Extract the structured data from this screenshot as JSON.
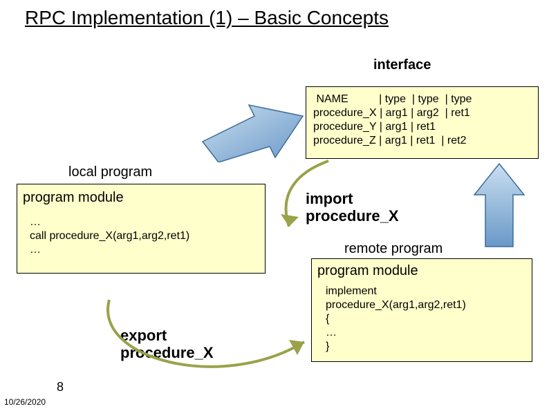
{
  "title": "RPC Implementation (1) – Basic Concepts",
  "labels": {
    "interface": "interface",
    "local_program": "local program",
    "import": "import\nprocedure_X",
    "remote_program": "remote program",
    "export": "export\nprocedure_X"
  },
  "interface_box": {
    "line1": " NAME          | type  | type  | type",
    "line2": "procedure_X | arg1 | arg2  | ret1",
    "line3": "procedure_Y | arg1 | ret1",
    "line4": "procedure_Z | arg1 | ret1  | ret2"
  },
  "local_module": {
    "heading": "program module",
    "body1": "…",
    "body2": "call procedure_X(arg1,arg2,ret1)",
    "body3": "…"
  },
  "remote_module": {
    "heading": "program module",
    "body1": "implement",
    "body2": "procedure_X(arg1,arg2,ret1)",
    "body3": "{",
    "body4": "…",
    "body5": "}"
  },
  "footer": {
    "date": "10/26/2020",
    "page": "8"
  }
}
